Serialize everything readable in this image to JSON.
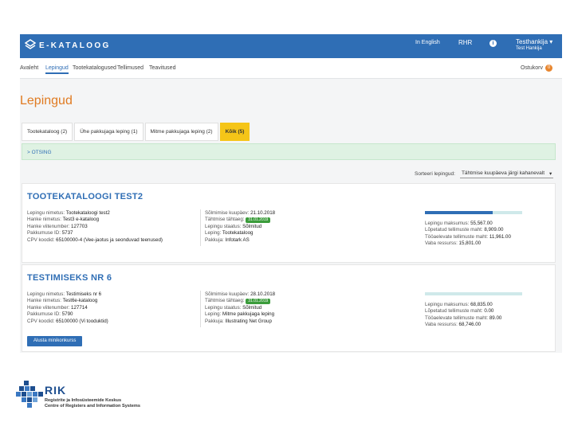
{
  "header": {
    "logo_text": "E-KATALOOG",
    "language": "In English",
    "rhr": "RHR",
    "user_name": "Testhankija",
    "user_org": "Test Hankija"
  },
  "nav": {
    "items": [
      "Avaleht",
      "Lepingud",
      "Tootekatalogused",
      "Tellimused",
      "Teavitused"
    ],
    "active_index": 1,
    "cart_label": "Ostukorv",
    "cart_count": "0"
  },
  "page_title": "Lepingud",
  "tabs": [
    {
      "label": "Tootekataloog (2)"
    },
    {
      "label": "Ühe pakkujaga leping (1)"
    },
    {
      "label": "Mitme pakkujaga leping (2)"
    },
    {
      "label": "Kõik (5)"
    }
  ],
  "search_label": "> OTSING",
  "sort": {
    "label": "Sorteeri lepingud:",
    "value": "Tähtmise kuupäeva järgi kahanevalt"
  },
  "contracts": [
    {
      "title": "TOOTEKATALOOGI TEST2",
      "left": [
        [
          "Lepingu nimetus:",
          "Tootekataloogi test2"
        ],
        [
          "Hanke nimetus:",
          "Test3 e-kataloog"
        ],
        [
          "Hanke viitenumber:",
          "127703"
        ],
        [
          "Pakkumuse ID:",
          "5737"
        ],
        [
          "CPV koodid:",
          "65100000-4 (Vee-jaotus ja seonduvad teenused)"
        ]
      ],
      "middle": [
        [
          "Sõlmimise kuupäev:",
          "21.10.2018"
        ],
        [
          "Tähtmise tähtaeg:",
          "31.01.2019"
        ],
        [
          "Lepingu staatus:",
          "Sõlmitud"
        ],
        [
          "Leping:",
          "Tootekataloog"
        ],
        [
          "Pakkuja:",
          "Infotark AS"
        ]
      ],
      "progress": 0.7,
      "right": [
        [
          "Lepingu maksumus:",
          "55,567.00"
        ],
        [
          "Lõpetatud tellimuste maht:",
          "8,909.00"
        ],
        [
          "Tööaelevate tellimuste maht:",
          "11,961.00"
        ],
        [
          "Vaba ressurss:",
          "15,801.00"
        ]
      ],
      "action": ""
    },
    {
      "title": "TESTIMISEKS NR 6",
      "left": [
        [
          "Lepingu nimetus:",
          "Testimiseks nr 6"
        ],
        [
          "Hanke nimetus:",
          "Test6e-kataloog"
        ],
        [
          "Hanke viitenumber:",
          "127714"
        ],
        [
          "Pakkumuse ID:",
          "5790"
        ],
        [
          "CPV koodid:",
          "65100000 (Vi tooduktid)"
        ]
      ],
      "middle": [
        [
          "Sõlmimise kuupäev:",
          "28.10.2018"
        ],
        [
          "Tähtmise tähtaeg:",
          "31.01.2019"
        ],
        [
          "Lepingu staatus:",
          "Sõlmitud"
        ],
        [
          "Leping:",
          "Mitme pakkujaga leping"
        ],
        [
          "Pakkuja:",
          "Illustrating Net Group"
        ]
      ],
      "progress": 0.0,
      "right": [
        [
          "Lepingu maksumus:",
          "68,835.00"
        ],
        [
          "Lõpetatud tellimuste maht:",
          "0.00"
        ],
        [
          "Tööaelevate tellimuste maht:",
          "89.00"
        ],
        [
          "Vaba ressurss:",
          "68,746.00"
        ]
      ],
      "action": "Alusta minikonkurss"
    }
  ],
  "footer": {
    "org_short": "RIK",
    "org_name_et": "Registrite ja Infosüsteemide Keskus",
    "org_name_en": "Centre of Registers and Information Systems"
  },
  "colors": {
    "brand_blue": "#2f6eb5",
    "title_orange": "#e07b22",
    "tab_active": "#f5c518",
    "search_bg": "#dff2e3",
    "badge_green": "#3b9c3b"
  }
}
